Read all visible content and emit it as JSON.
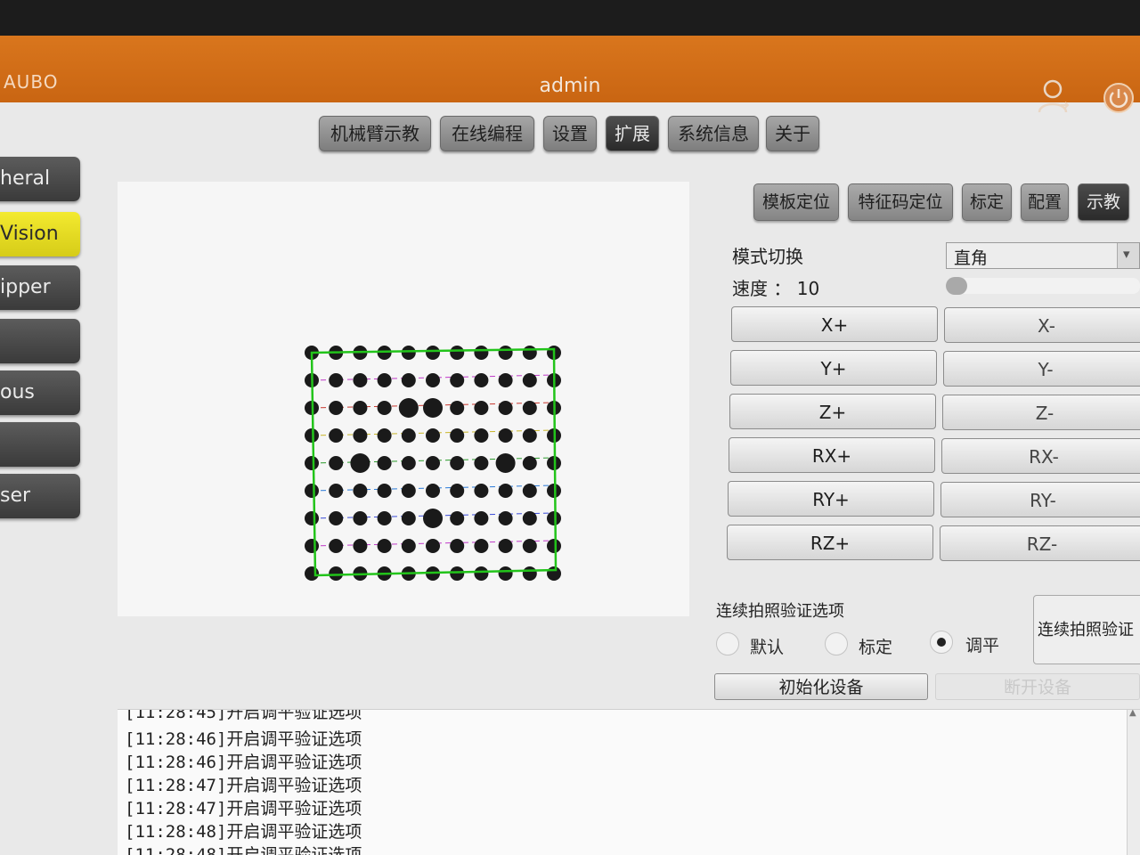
{
  "app": {
    "logo": "AUBO",
    "title": "admin"
  },
  "topnav": [
    {
      "label": "机械臂示教",
      "active": false
    },
    {
      "label": "在线编程",
      "active": false
    },
    {
      "label": "设置",
      "active": false
    },
    {
      "label": "扩展",
      "active": true
    },
    {
      "label": "系统信息",
      "active": false
    },
    {
      "label": "关于",
      "active": false
    }
  ],
  "sidebar": [
    {
      "label": "heral",
      "active": false
    },
    {
      "label": "Vision",
      "active": true
    },
    {
      "label": "ipper",
      "active": false
    },
    {
      "label": "",
      "active": false
    },
    {
      "label": "ous",
      "active": false
    },
    {
      "label": "",
      "active": false
    },
    {
      "label": "ser",
      "active": false
    }
  ],
  "subtabs": [
    {
      "label": "模板定位",
      "active": false
    },
    {
      "label": "特征码定位",
      "active": false
    },
    {
      "label": "标定",
      "active": false
    },
    {
      "label": "配置",
      "active": false
    },
    {
      "label": "示教",
      "active": true
    }
  ],
  "mode": {
    "label": "模式切换",
    "value": "直角"
  },
  "speed": {
    "label": "速度 ： 10",
    "value": 10
  },
  "jog": {
    "plus": [
      "X+",
      "Y+",
      "Z+",
      "RX+",
      "RY+",
      "RZ+"
    ],
    "minus": [
      "X-",
      "Y-",
      "Z-",
      "RX-",
      "RY-",
      "RZ-"
    ]
  },
  "verify": {
    "title": "连续拍照验证选项",
    "options": [
      {
        "label": "默认",
        "selected": false
      },
      {
        "label": "标定",
        "selected": false
      },
      {
        "label": "调平",
        "selected": true
      }
    ],
    "side_button": "连续拍照验证",
    "init_button": "初始化设备",
    "disconnect_button": "断开设备"
  },
  "log": {
    "partial_top": "[11:28:45]开启调平验证选项",
    "lines": [
      "[11:28:46]开启调平验证选项",
      "[11:28:46]开启调平验证选项",
      "[11:28:47]开启调平验证选项",
      "[11:28:47]开启调平验证选项",
      "[11:28:48]开启调平验证选项"
    ],
    "partial_bottom": "[11:28:48]开启调平验证选项"
  },
  "calibration_grid": {
    "rows": 9,
    "cols": 11,
    "box_color": "#22c41a",
    "dot_color": "#1a1a1a"
  },
  "colors": {
    "titlebar": "#d06a16",
    "vision_active": "#e6dc22"
  }
}
